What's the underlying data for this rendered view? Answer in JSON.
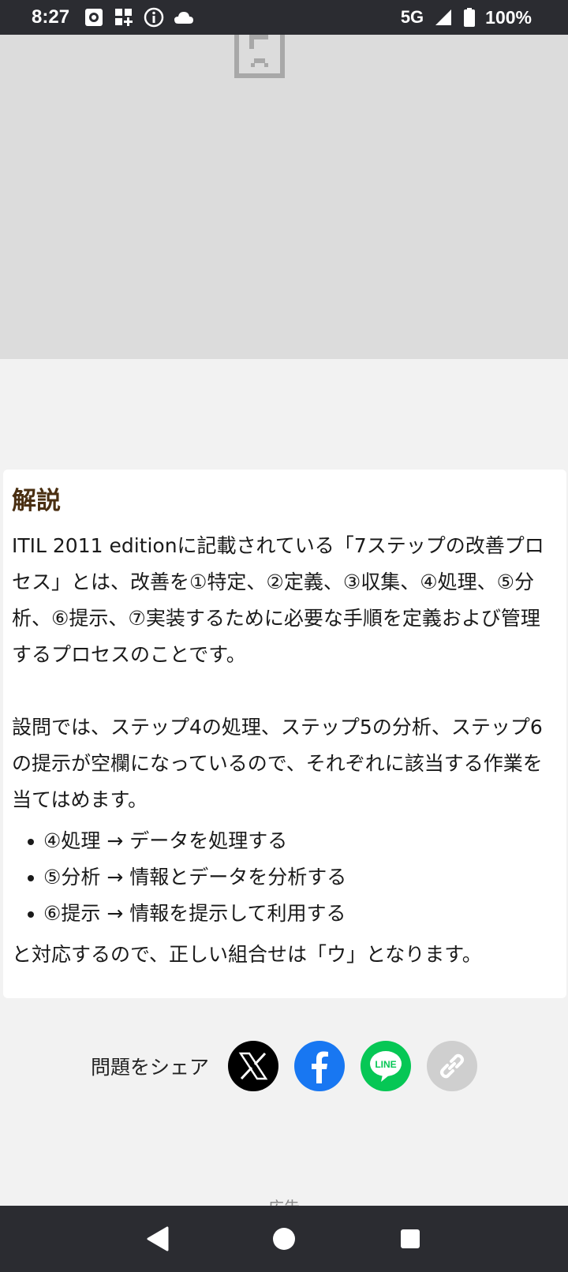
{
  "status_bar": {
    "time": "8:27",
    "network": "5G",
    "battery": "100%"
  },
  "image_placeholder": {
    "icon": "broken-image-icon"
  },
  "explanation": {
    "title": "解説",
    "paragraph1": "ITIL 2011 editionに記載されている「7ステップの改善プロセス」とは、改善を①特定、②定義、③収集、④処理、⑤分析、⑥提示、⑦実装するために必要な手順を定義および管理するプロセスのことです。",
    "paragraph2": "設問では、ステップ4の処理、ステップ5の分析、ステップ6の提示が空欄になっているので、それぞれに該当する作業を当てはめます。",
    "items": [
      "④処理 → データを処理する",
      "⑤分析 → 情報とデータを分析する",
      "⑥提示 → 情報を提示して利用する"
    ],
    "conclusion": "と対応するので、正しい組合せは「ウ」となります。"
  },
  "share": {
    "label": "問題をシェア",
    "buttons": {
      "x": "x-icon",
      "facebook": "facebook-icon",
      "line": "LINE",
      "link": "link-icon"
    }
  },
  "ad_label": "広告",
  "colors": {
    "status_bar_bg": "#2b2c31",
    "title_color": "#4a2f12",
    "facebook": "#1877f2",
    "line": "#06c755"
  }
}
